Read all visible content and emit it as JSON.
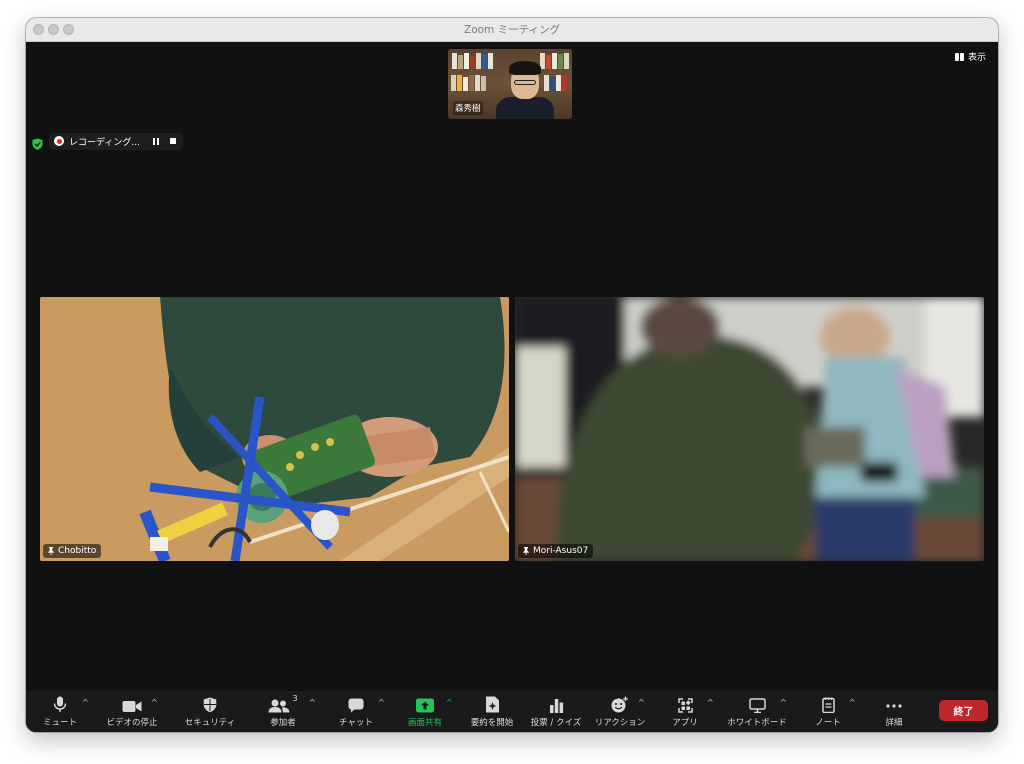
{
  "window": {
    "title": "Zoom ミーティング"
  },
  "header": {
    "view_label": "表示"
  },
  "recording": {
    "label": "レコーディング..."
  },
  "thumbnail": {
    "name": "森秀樹"
  },
  "tiles": [
    {
      "name": "Chobitto"
    },
    {
      "name": "Mori-Asus07"
    }
  ],
  "toolbar": {
    "items": [
      {
        "label": "ミュート",
        "icon": "microphone-icon"
      },
      {
        "label": "ビデオの停止",
        "icon": "video-camera-icon"
      },
      {
        "label": "セキュリティ",
        "icon": "shield-icon"
      },
      {
        "label": "参加者",
        "icon": "participants-icon",
        "count": "3"
      },
      {
        "label": "チャット",
        "icon": "chat-icon"
      },
      {
        "label": "画面共有",
        "icon": "share-screen-icon"
      },
      {
        "label": "要約を開始",
        "icon": "summary-icon"
      },
      {
        "label": "投票 / クイズ",
        "icon": "poll-icon"
      },
      {
        "label": "リアクション",
        "icon": "reaction-icon"
      },
      {
        "label": "アプリ",
        "icon": "apps-icon"
      },
      {
        "label": "ホワイトボード",
        "icon": "whiteboard-icon"
      },
      {
        "label": "ノート",
        "icon": "notes-icon"
      },
      {
        "label": "詳細",
        "icon": "more-icon"
      }
    ],
    "end_label": "終了"
  },
  "colors": {
    "share_green": "#22c35a",
    "end_red": "#c1262d",
    "shield_green": "#2ec24a"
  }
}
